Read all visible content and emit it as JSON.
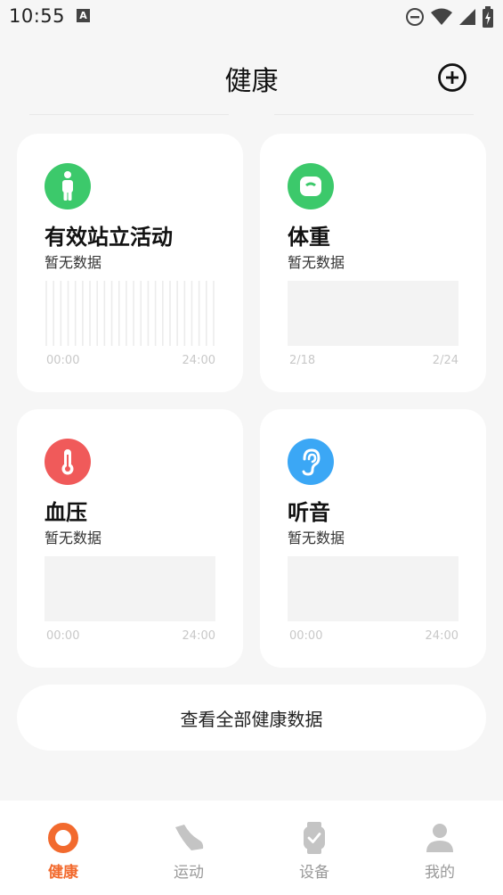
{
  "status_bar": {
    "time": "10:55",
    "a_badge": "A"
  },
  "header": {
    "title": "健康"
  },
  "cards": [
    {
      "title": "有效站立活动",
      "subtitle": "暂无数据",
      "axis_start": "00:00",
      "axis_end": "24:00",
      "icon": "standing-person-icon",
      "color": "#3cc96b"
    },
    {
      "title": "体重",
      "subtitle": "暂无数据",
      "axis_start": "2/18",
      "axis_end": "2/24",
      "icon": "scale-icon",
      "color": "#3cc96b"
    },
    {
      "title": "血压",
      "subtitle": "暂无数据",
      "axis_start": "00:00",
      "axis_end": "24:00",
      "icon": "thermometer-icon",
      "color": "#f05a5a"
    },
    {
      "title": "听音",
      "subtitle": "暂无数据",
      "axis_start": "00:00",
      "axis_end": "24:00",
      "icon": "ear-icon",
      "color": "#3ba7f5"
    }
  ],
  "view_all": {
    "label": "查看全部健康数据"
  },
  "bottom_nav": [
    {
      "label": "健康",
      "icon": "health-ring-icon",
      "active": true
    },
    {
      "label": "运动",
      "icon": "shoe-icon",
      "active": false
    },
    {
      "label": "设备",
      "icon": "watch-icon",
      "active": false
    },
    {
      "label": "我的",
      "icon": "person-icon",
      "active": false
    }
  ],
  "colors": {
    "accent": "#f26a2e",
    "background": "#f6f6f6",
    "inactive": "#c4c4c4"
  }
}
